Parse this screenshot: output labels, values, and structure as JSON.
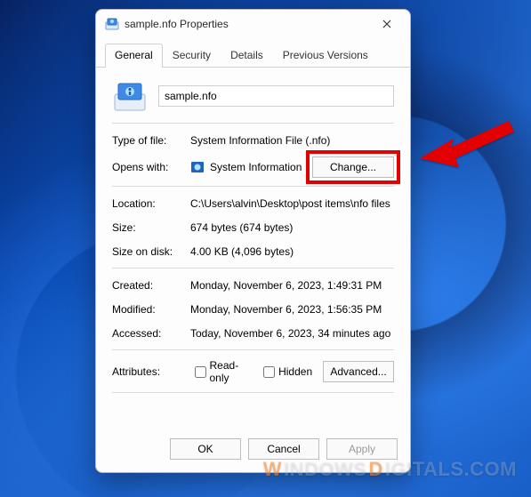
{
  "window": {
    "title": "sample.nfo Properties"
  },
  "tabs": {
    "general": "General",
    "security": "Security",
    "details": "Details",
    "previous": "Previous Versions"
  },
  "file": {
    "name": "sample.nfo"
  },
  "rows": {
    "type_label": "Type of file:",
    "type_value": "System Information File (.nfo)",
    "opens_label": "Opens with:",
    "opens_app": "System Information",
    "change_label": "Change...",
    "location_label": "Location:",
    "location_value": "C:\\Users\\alvin\\Desktop\\post items\\nfo files",
    "size_label": "Size:",
    "size_value": "674 bytes (674 bytes)",
    "sizeondisk_label": "Size on disk:",
    "sizeondisk_value": "4.00 KB (4,096 bytes)",
    "created_label": "Created:",
    "created_value": "Monday, November 6, 2023, 1:49:31 PM",
    "modified_label": "Modified:",
    "modified_value": "Monday, November 6, 2023, 1:56:35 PM",
    "accessed_label": "Accessed:",
    "accessed_value": "Today, November 6, 2023, 34 minutes ago",
    "attributes_label": "Attributes:",
    "readonly_label": "Read-only",
    "hidden_label": "Hidden",
    "advanced_label": "Advanced..."
  },
  "footer": {
    "ok": "OK",
    "cancel": "Cancel",
    "apply": "Apply"
  },
  "watermark": {
    "w": "W",
    "rest": "INDOWS",
    "d": "D",
    "rest2": "IGITALS.COM"
  }
}
